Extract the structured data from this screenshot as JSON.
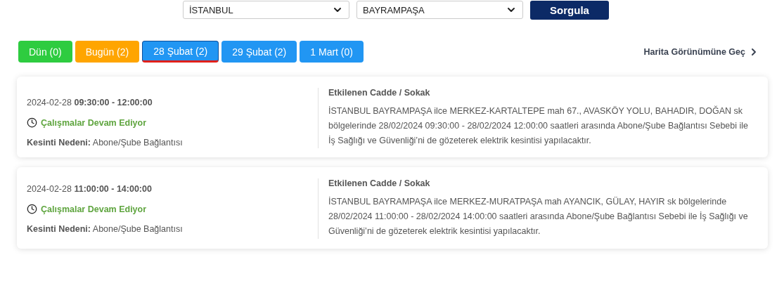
{
  "filters": {
    "province": "İSTANBUL",
    "district": "BAYRAMPAŞA",
    "submit": "Sorgula"
  },
  "tabs": [
    {
      "label": "Dün (0)",
      "color": "#2ecc40",
      "selected": false
    },
    {
      "label": "Bugün (2)",
      "color": "#ffa500",
      "selected": false
    },
    {
      "label": "28 Şubat (2)",
      "color": "#2196f3",
      "selected": true
    },
    {
      "label": "29 Şubat (2)",
      "color": "#2196f3",
      "selected": false
    },
    {
      "label": "1 Mart (0)",
      "color": "#2196f3",
      "selected": false
    }
  ],
  "map_link": "Harita Görünümüne Geç",
  "outages": [
    {
      "date": "2024-02-28",
      "time": "09:30:00 - 12:00:00",
      "status": "Çalışmalar Devam Ediyor",
      "reason_label": "Kesinti Nedeni:",
      "reason": "Abone/Şube Bağlantısı",
      "area_title": "Etkilenen Cadde / Sokak",
      "description": "İSTANBUL BAYRAMPAŞA ilce MERKEZ-KARTALTEPE mah 67., AVASKÖY YOLU, BAHADIR, DOĞAN sk bölgelerinde 28/02/2024 09:30:00 - 28/02/2024 12:00:00 saatleri arasında Abone/Şube Bağlantısı Sebebi ile İş Sağlığı ve Güvenliği’ni de gözeterek elektrik kesintisi yapılacaktır."
    },
    {
      "date": "2024-02-28",
      "time": "11:00:00 - 14:00:00",
      "status": "Çalışmalar Devam Ediyor",
      "reason_label": "Kesinti Nedeni:",
      "reason": "Abone/Şube Bağlantısı",
      "area_title": "Etkilenen Cadde / Sokak",
      "description": "İSTANBUL BAYRAMPAŞA ilce MERKEZ-MURATPAŞA mah AYANCIK, GÜLAY, HAYIR sk bölgelerinde 28/02/2024 11:00:00 - 28/02/2024 14:00:00 saatleri arasında Abone/Şube Bağlantısı Sebebi ile İş Sağlığı ve Güvenliği’ni de gözeterek elektrik kesintisi yapılacaktır."
    }
  ]
}
